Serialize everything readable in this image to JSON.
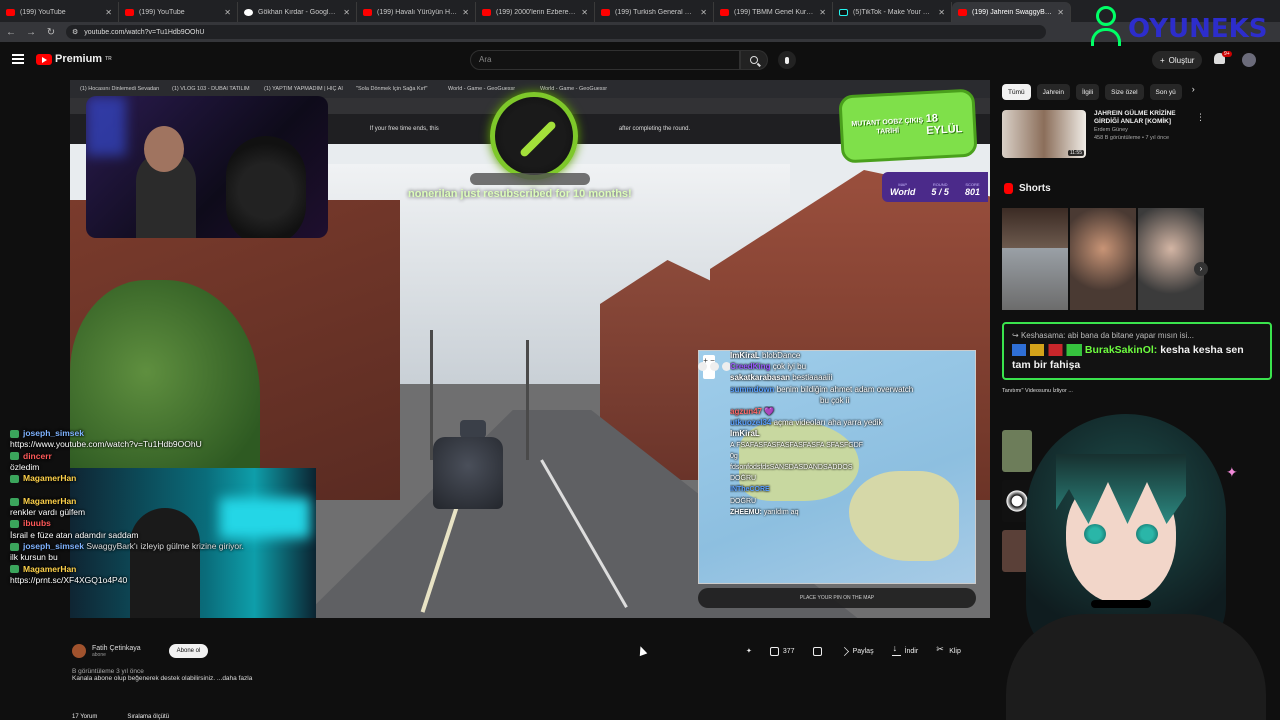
{
  "browser": {
    "tabs": [
      {
        "label": "(199) YouTube",
        "icon": "youtube-icon"
      },
      {
        "label": "(199) YouTube",
        "icon": "youtube-icon"
      },
      {
        "label": "Gökhan Kırdar - Google Search",
        "icon": "google-icon"
      },
      {
        "label": "(199) Havalı Yürüyün Havalı, Ka",
        "icon": "youtube-icon"
      },
      {
        "label": "(199) 2000'lerin Ezbere Bilinen",
        "icon": "youtube-icon"
      },
      {
        "label": "(199) Turkish General Election",
        "icon": "youtube-icon"
      },
      {
        "label": "(199) TBMM Genel Kurulu 2020",
        "icon": "youtube-icon"
      },
      {
        "label": "(5)TikTok - Make Your Day",
        "icon": "tiktok-icon"
      },
      {
        "label": "(199) Jahrein SwaggyBark'",
        "icon": "youtube-icon"
      }
    ],
    "url": "youtube.com/watch?v=Tu1Hdb9OOhU"
  },
  "youtube": {
    "logo": "Premium",
    "logo_sup": "TR",
    "search_placeholder": "Ara",
    "create_label": "Oluştur",
    "notif_count": "9+"
  },
  "watermark": "OYUNEKS",
  "stream_overlay": {
    "browser_tabs": [
      "(1) Hocasını Dinlemedi Sevadan",
      "(1) VLOG 103 - DUBAI TATILIM",
      "(1) YAPTIM YAPMADIM | HİÇ AI",
      "\"Sola Dönmek İçin Sağa Kırf\"",
      "World - Game - GeoGuessr",
      "World - Game - GeoGuessr"
    ],
    "notice_left": "If your free time ends, this",
    "notice_right": "after completing the round.",
    "sub_message": "nonerilan just resubscribed for 10 months!",
    "mutant_title": "MUTANT OOBZ ÇIKIŞ TARİHİ",
    "mutant_date": "18 EYLÜL",
    "score": {
      "map_label": "MAP",
      "map": "World",
      "round_label": "ROUND",
      "round": "5 / 5",
      "score_label": "SCORE",
      "score": "801"
    },
    "map_guess": "PLACE YOUR PIN ON THE MAP",
    "map_zoom": "+ −",
    "chat_right": [
      {
        "user": "ImKiraL",
        "msg": "blobDance",
        "color": "#ffffff"
      },
      {
        "user": "CreedKing",
        "msg": "çok iyi bu",
        "color": "#9b59ff"
      },
      {
        "user": "sakatkarabasan",
        "msg": "bestiaaaaiii",
        "color": "#ffffff"
      },
      {
        "user": "summdown",
        "msg": "benim bildiğim ahmet adam overwatch",
        "color": "#5aa0ff"
      },
      {
        "user": "",
        "msg": "bu çok ii",
        "color": "#ffffff"
      },
      {
        "user": "agzun47",
        "msg": "💜",
        "color": "#ff6a6a"
      },
      {
        "user": "utkuozel34",
        "msg": "açma videoları aha yarra yedik",
        "color": "#5aa0ff"
      },
      {
        "user": "ImKiraL",
        "msg": "",
        "color": "#ffffff"
      },
      {
        "user": "",
        "msg": "A FSAFASFASFASFASFASFA SFASFGDF",
        "color": "#ffffff"
      },
      {
        "user": "",
        "msg": "0g",
        "color": "#ffffff"
      },
      {
        "user": "",
        "msg": "fdsonfodsfdsSANSDASDANDSADDOS",
        "color": "#ffffff"
      },
      {
        "user": "",
        "msg": "DOĞRU",
        "color": "#ffffff"
      },
      {
        "user": "INTheCORE",
        "msg": "",
        "color": "#5aa0ff"
      },
      {
        "user": "",
        "msg": "DOĞRU",
        "color": "#ffffff"
      },
      {
        "user": "ZHEEMU:",
        "msg": "yarıldım aq",
        "color": "#ffffff"
      }
    ],
    "chat_left": [
      {
        "user": "joseph_simsek",
        "msg": "",
        "color": "#7fb3ff"
      },
      {
        "user": "",
        "msg": "https://www.youtube.com/watch?v=Tu1Hdb9OOhU",
        "color": "#ffffff"
      },
      {
        "user": "dincerr",
        "msg": "",
        "color": "#ff5a5a"
      },
      {
        "user": "",
        "msg": "özledim",
        "color": "#ffffff"
      },
      {
        "user": "MagamerHan",
        "msg": "",
        "color": "#ffd24a"
      },
      {
        "user": "",
        "msg": "",
        "color": "#ffffff"
      },
      {
        "user": "MagamerHan",
        "msg": "",
        "color": "#ffd24a"
      },
      {
        "user": "",
        "msg": "renkler vardı gülfem",
        "color": "#ffffff"
      },
      {
        "user": "ibuubs",
        "msg": "",
        "color": "#ff5a5a"
      },
      {
        "user": "",
        "msg": "İsrail e füze atan adamdır saddam",
        "color": "#ffffff"
      },
      {
        "user": "joseph_simsek",
        "msg": "SwaggyBark'ı izleyip gülme krizine giriyor.",
        "color": "#7fb3ff"
      },
      {
        "user": "",
        "msg": "ilk kursun bu",
        "color": "#ffffff"
      },
      {
        "user": "MagamerHan",
        "msg": "",
        "color": "#ffd24a"
      },
      {
        "user": "",
        "msg": "https://prnt.sc/XF4XGQ1o4P40",
        "color": "#ffffff"
      }
    ]
  },
  "channel": {
    "name": "Fatih Çetinkaya",
    "subs": "abone",
    "subscribe": "Abone ol"
  },
  "actions": {
    "likes": "377",
    "share": "Paylaş",
    "download": "İndir",
    "clip": "Klip"
  },
  "description": {
    "meta": "B görüntüleme  3 yıl önce",
    "text": "Kanala abone olup beğenerek destek olabilirsiniz. ...daha fazla"
  },
  "comments": {
    "count": "17 Yorum",
    "sort": "Sıralama ölçütü"
  },
  "sidebar": {
    "chips": [
      "Tümü",
      "Jahrein",
      "İlgili",
      "Size özel",
      "Son yü"
    ],
    "rec1": {
      "title": "JAHREIN GÜLME KRİZİNE GİRDİĞİ ANLAR [KOMİK]",
      "channel": "Erdem Güney",
      "meta": "458 B görüntüleme • 7 yıl önce",
      "duration": "11:55"
    },
    "shorts_title": "Shorts",
    "gchat_reply": "Keshasama: abi bana da bitane yapar mısın isi...",
    "gchat_user": "BurakSakinOl:",
    "gchat_msg": "kesha kesha sen tam bir fahişa",
    "rec2_title": "Tanıtımı\" Videosunu İzliyor ..."
  }
}
